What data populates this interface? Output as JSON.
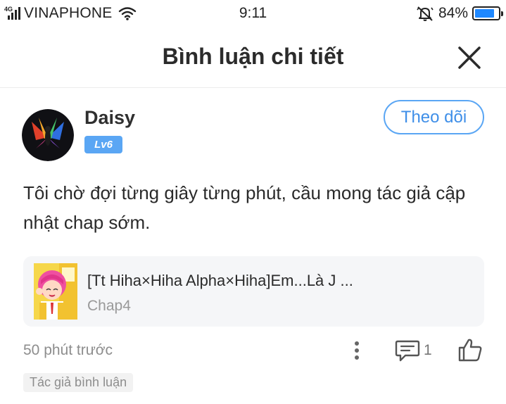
{
  "status_bar": {
    "network": "4G",
    "carrier": "VINAPHONE",
    "time": "9:11",
    "battery_percent": "84%",
    "battery_level": 0.84,
    "icons": [
      "signal-icon",
      "wifi-icon",
      "alarm-off-icon",
      "battery-icon"
    ]
  },
  "header": {
    "title": "Bình luận chi tiết",
    "close_icon": "close-icon"
  },
  "comment": {
    "username": "Daisy",
    "level": "Lv6",
    "follow_label": "Theo dõi",
    "text": "Tôi chờ đợi từng giây từng phút, cầu mong tác giả cập nhật chap sớm.",
    "time_ago": "50 phút trước",
    "reply_count": "1",
    "author_tag": "Tác giả bình luận"
  },
  "chapter": {
    "title": "[Tt Hiha×Hiha Alpha×Hiha]Em...Là J ...",
    "subtitle": "Chap4"
  },
  "colors": {
    "accent": "#5aa6f4",
    "battery": "#1e88ff",
    "card_bg": "#f5f6f8"
  }
}
